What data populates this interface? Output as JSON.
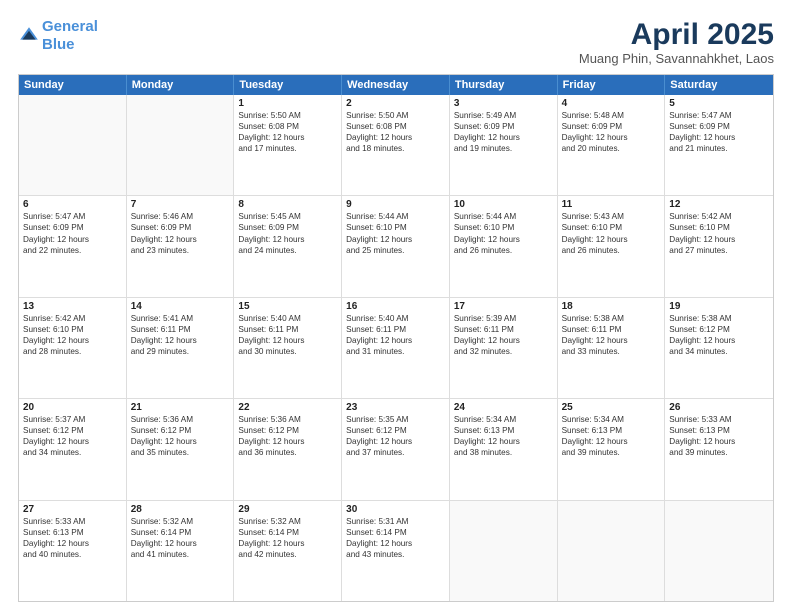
{
  "header": {
    "logo_line1": "General",
    "logo_line2": "Blue",
    "title": "April 2025",
    "subtitle": "Muang Phin, Savannahkhet, Laos"
  },
  "calendar": {
    "days_of_week": [
      "Sunday",
      "Monday",
      "Tuesday",
      "Wednesday",
      "Thursday",
      "Friday",
      "Saturday"
    ],
    "weeks": [
      [
        {
          "day": "",
          "lines": []
        },
        {
          "day": "",
          "lines": []
        },
        {
          "day": "1",
          "lines": [
            "Sunrise: 5:50 AM",
            "Sunset: 6:08 PM",
            "Daylight: 12 hours",
            "and 17 minutes."
          ]
        },
        {
          "day": "2",
          "lines": [
            "Sunrise: 5:50 AM",
            "Sunset: 6:08 PM",
            "Daylight: 12 hours",
            "and 18 minutes."
          ]
        },
        {
          "day": "3",
          "lines": [
            "Sunrise: 5:49 AM",
            "Sunset: 6:09 PM",
            "Daylight: 12 hours",
            "and 19 minutes."
          ]
        },
        {
          "day": "4",
          "lines": [
            "Sunrise: 5:48 AM",
            "Sunset: 6:09 PM",
            "Daylight: 12 hours",
            "and 20 minutes."
          ]
        },
        {
          "day": "5",
          "lines": [
            "Sunrise: 5:47 AM",
            "Sunset: 6:09 PM",
            "Daylight: 12 hours",
            "and 21 minutes."
          ]
        }
      ],
      [
        {
          "day": "6",
          "lines": [
            "Sunrise: 5:47 AM",
            "Sunset: 6:09 PM",
            "Daylight: 12 hours",
            "and 22 minutes."
          ]
        },
        {
          "day": "7",
          "lines": [
            "Sunrise: 5:46 AM",
            "Sunset: 6:09 PM",
            "Daylight: 12 hours",
            "and 23 minutes."
          ]
        },
        {
          "day": "8",
          "lines": [
            "Sunrise: 5:45 AM",
            "Sunset: 6:09 PM",
            "Daylight: 12 hours",
            "and 24 minutes."
          ]
        },
        {
          "day": "9",
          "lines": [
            "Sunrise: 5:44 AM",
            "Sunset: 6:10 PM",
            "Daylight: 12 hours",
            "and 25 minutes."
          ]
        },
        {
          "day": "10",
          "lines": [
            "Sunrise: 5:44 AM",
            "Sunset: 6:10 PM",
            "Daylight: 12 hours",
            "and 26 minutes."
          ]
        },
        {
          "day": "11",
          "lines": [
            "Sunrise: 5:43 AM",
            "Sunset: 6:10 PM",
            "Daylight: 12 hours",
            "and 26 minutes."
          ]
        },
        {
          "day": "12",
          "lines": [
            "Sunrise: 5:42 AM",
            "Sunset: 6:10 PM",
            "Daylight: 12 hours",
            "and 27 minutes."
          ]
        }
      ],
      [
        {
          "day": "13",
          "lines": [
            "Sunrise: 5:42 AM",
            "Sunset: 6:10 PM",
            "Daylight: 12 hours",
            "and 28 minutes."
          ]
        },
        {
          "day": "14",
          "lines": [
            "Sunrise: 5:41 AM",
            "Sunset: 6:11 PM",
            "Daylight: 12 hours",
            "and 29 minutes."
          ]
        },
        {
          "day": "15",
          "lines": [
            "Sunrise: 5:40 AM",
            "Sunset: 6:11 PM",
            "Daylight: 12 hours",
            "and 30 minutes."
          ]
        },
        {
          "day": "16",
          "lines": [
            "Sunrise: 5:40 AM",
            "Sunset: 6:11 PM",
            "Daylight: 12 hours",
            "and 31 minutes."
          ]
        },
        {
          "day": "17",
          "lines": [
            "Sunrise: 5:39 AM",
            "Sunset: 6:11 PM",
            "Daylight: 12 hours",
            "and 32 minutes."
          ]
        },
        {
          "day": "18",
          "lines": [
            "Sunrise: 5:38 AM",
            "Sunset: 6:11 PM",
            "Daylight: 12 hours",
            "and 33 minutes."
          ]
        },
        {
          "day": "19",
          "lines": [
            "Sunrise: 5:38 AM",
            "Sunset: 6:12 PM",
            "Daylight: 12 hours",
            "and 34 minutes."
          ]
        }
      ],
      [
        {
          "day": "20",
          "lines": [
            "Sunrise: 5:37 AM",
            "Sunset: 6:12 PM",
            "Daylight: 12 hours",
            "and 34 minutes."
          ]
        },
        {
          "day": "21",
          "lines": [
            "Sunrise: 5:36 AM",
            "Sunset: 6:12 PM",
            "Daylight: 12 hours",
            "and 35 minutes."
          ]
        },
        {
          "day": "22",
          "lines": [
            "Sunrise: 5:36 AM",
            "Sunset: 6:12 PM",
            "Daylight: 12 hours",
            "and 36 minutes."
          ]
        },
        {
          "day": "23",
          "lines": [
            "Sunrise: 5:35 AM",
            "Sunset: 6:12 PM",
            "Daylight: 12 hours",
            "and 37 minutes."
          ]
        },
        {
          "day": "24",
          "lines": [
            "Sunrise: 5:34 AM",
            "Sunset: 6:13 PM",
            "Daylight: 12 hours",
            "and 38 minutes."
          ]
        },
        {
          "day": "25",
          "lines": [
            "Sunrise: 5:34 AM",
            "Sunset: 6:13 PM",
            "Daylight: 12 hours",
            "and 39 minutes."
          ]
        },
        {
          "day": "26",
          "lines": [
            "Sunrise: 5:33 AM",
            "Sunset: 6:13 PM",
            "Daylight: 12 hours",
            "and 39 minutes."
          ]
        }
      ],
      [
        {
          "day": "27",
          "lines": [
            "Sunrise: 5:33 AM",
            "Sunset: 6:13 PM",
            "Daylight: 12 hours",
            "and 40 minutes."
          ]
        },
        {
          "day": "28",
          "lines": [
            "Sunrise: 5:32 AM",
            "Sunset: 6:14 PM",
            "Daylight: 12 hours",
            "and 41 minutes."
          ]
        },
        {
          "day": "29",
          "lines": [
            "Sunrise: 5:32 AM",
            "Sunset: 6:14 PM",
            "Daylight: 12 hours",
            "and 42 minutes."
          ]
        },
        {
          "day": "30",
          "lines": [
            "Sunrise: 5:31 AM",
            "Sunset: 6:14 PM",
            "Daylight: 12 hours",
            "and 43 minutes."
          ]
        },
        {
          "day": "",
          "lines": []
        },
        {
          "day": "",
          "lines": []
        },
        {
          "day": "",
          "lines": []
        }
      ]
    ]
  }
}
